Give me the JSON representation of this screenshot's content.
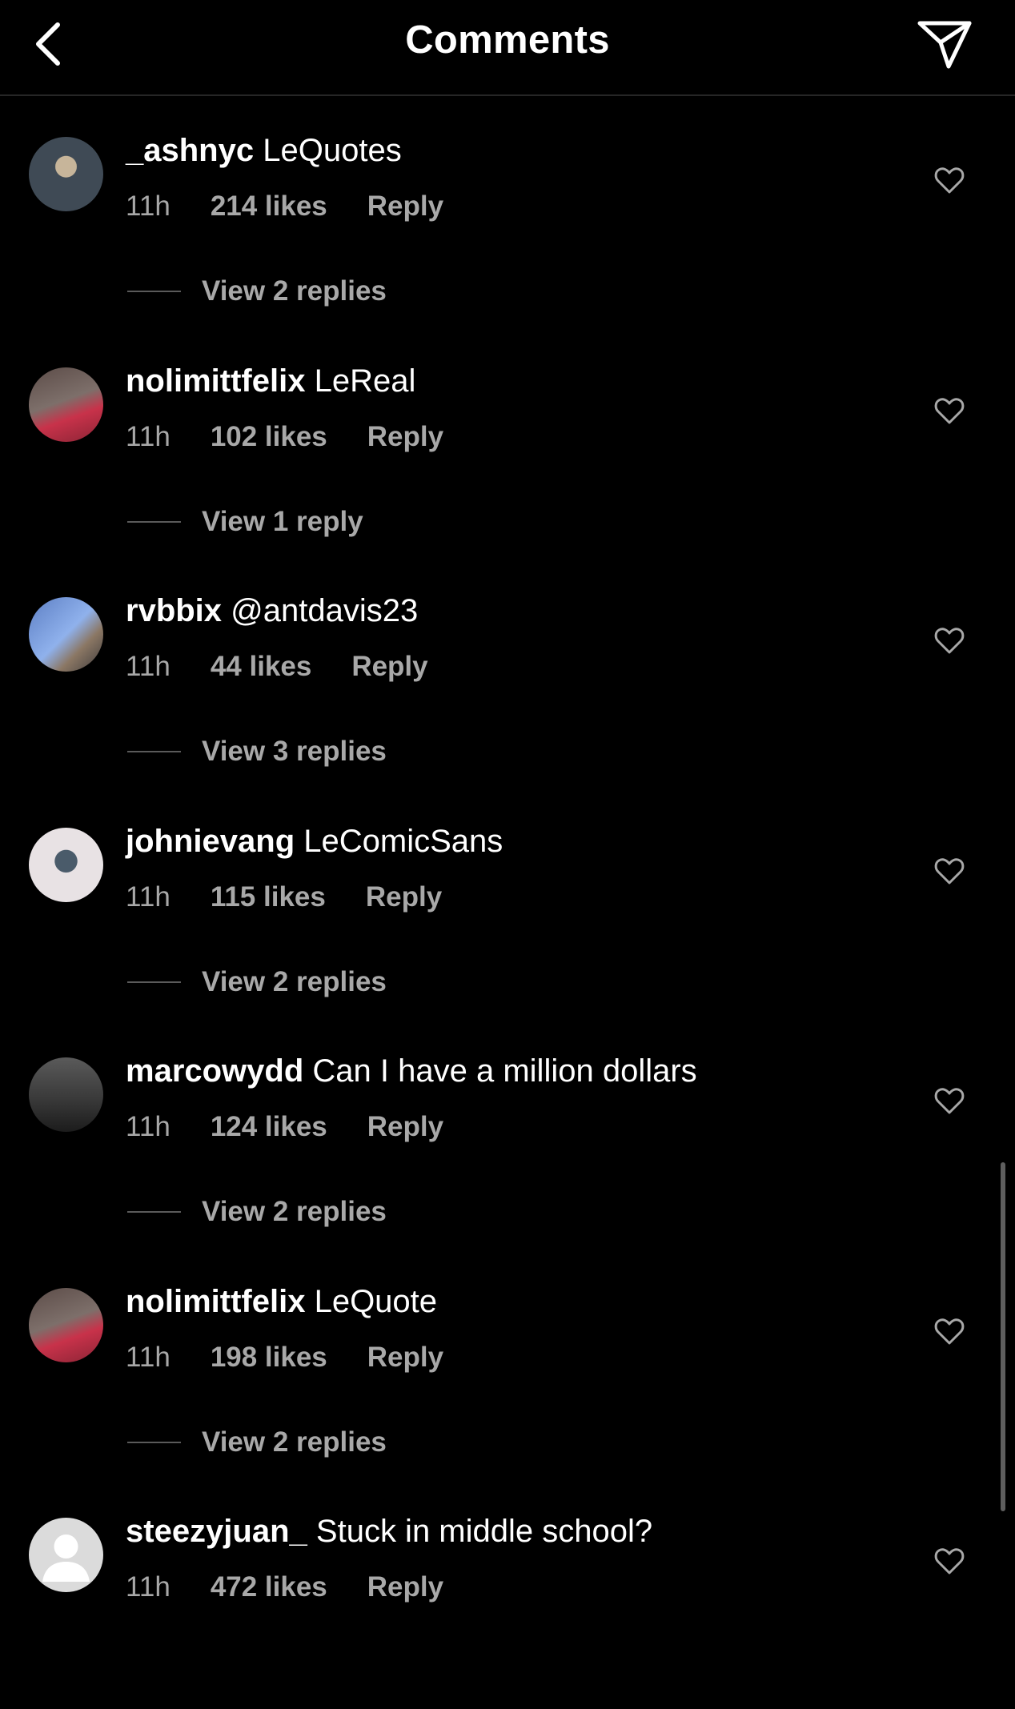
{
  "header": {
    "title": "Comments",
    "back_icon": "chevron-left-icon",
    "share_icon": "paper-plane-icon"
  },
  "comments": [
    {
      "username": "_ashnyc",
      "text": "LeQuotes",
      "time": "11h",
      "likes": "214 likes",
      "reply": "Reply",
      "view_replies": "View 2 replies",
      "avatar_colors": [
        "#3f4a55",
        "#c7b59a"
      ]
    },
    {
      "username": "nolimittfelix",
      "text": "LeReal",
      "time": "11h",
      "likes": "102 likes",
      "reply": "Reply",
      "view_replies": "View 1 reply",
      "avatar_colors": [
        "#6f5f5c",
        "#c8324a"
      ]
    },
    {
      "username": "rvbbix",
      "text": "@antdavis23",
      "time": "11h",
      "likes": "44 likes",
      "reply": "Reply",
      "view_replies": "View 3 replies",
      "avatar_colors": [
        "#6f95d6",
        "#8b7764"
      ]
    },
    {
      "username": "johnievang",
      "text": "LeComicSans",
      "time": "11h",
      "likes": "115 likes",
      "reply": "Reply",
      "view_replies": "View 2 replies",
      "avatar_colors": [
        "#e8e2e4",
        "#4a5b6a"
      ]
    },
    {
      "username": "marcowydd",
      "text": "Can I have a million dollars",
      "time": "11h",
      "likes": "124 likes",
      "reply": "Reply",
      "view_replies": "View 2 replies",
      "avatar_colors": [
        "#4b4b4b",
        "#262626"
      ]
    },
    {
      "username": "nolimittfelix",
      "text": "LeQuote",
      "time": "11h",
      "likes": "198 likes",
      "reply": "Reply",
      "view_replies": "View 2 replies",
      "avatar_colors": [
        "#6f5f5c",
        "#c8324a"
      ]
    },
    {
      "username": "steezyjuan_",
      "text": "Stuck in middle school?",
      "time": "11h",
      "likes": "472 likes",
      "reply": "Reply",
      "view_replies": "",
      "avatar_colors": [
        "#d9d9d9",
        "#ffffff"
      ]
    }
  ]
}
